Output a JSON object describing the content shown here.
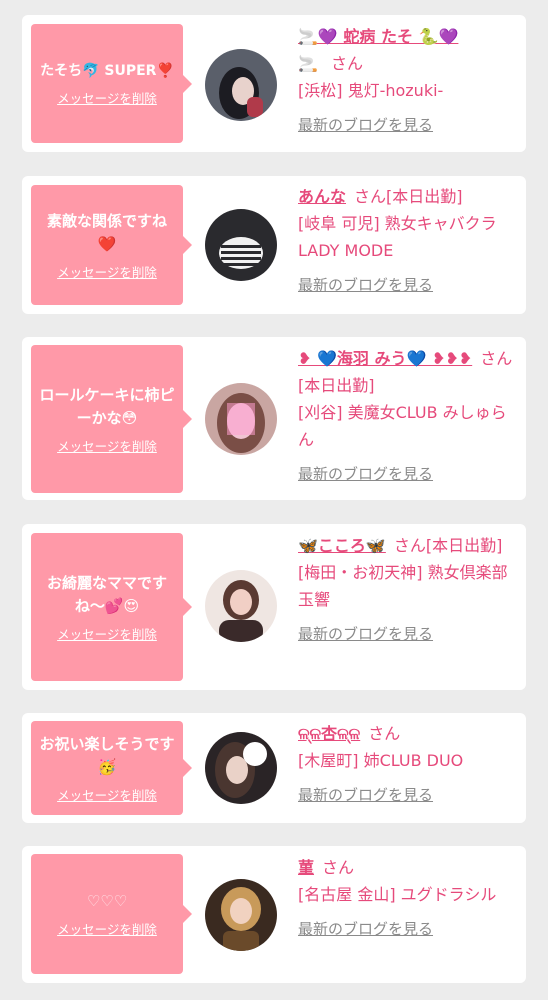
{
  "colors": {
    "page_bg": "#ececec",
    "card_bg": "#ffffff",
    "bubble_bg": "#ff99a8",
    "accent_pink": "#e64a7b",
    "link_gray": "#8a8a8a"
  },
  "common": {
    "delete_label": "メッセージを削除",
    "blog_label": "最新のブログを見る",
    "san_label": "さん"
  },
  "cards": [
    {
      "message": "たそち🐬 SUPER❣️",
      "name": "🚬💜 蛇病 たそ 🐍💜",
      "name_suffix": "🚬",
      "status": "",
      "shop": "[浜松] 鬼灯-hozuki-",
      "avatar_icon": "woman-photo-icon"
    },
    {
      "message": "素敵な関係ですね❤️",
      "name": "あんな",
      "status": "[本日出勤]",
      "shop": "[岐阜 可児] 熟女キャバクラ LADY MODE",
      "avatar_icon": "logo-photo-icon"
    },
    {
      "message": "ロールケーキに柿ピーかな😳",
      "name": "❥ 💙海羽 みう💙 ❥❥❥",
      "status": "[本日出勤]",
      "shop": "[刈谷] 美魔女CLUB みしゅらん",
      "avatar_icon": "blurred-woman-photo-icon"
    },
    {
      "message": "お綺麗なママですね〜💕😍",
      "name": "🦋こころ🦋",
      "status": "[本日出勤]",
      "shop": "[梅田・お初天神] 熟女倶楽部 玉響",
      "avatar_icon": "woman-photo-icon"
    },
    {
      "message": "お祝い楽しそうです🥳",
      "name": "ଳ୍ଳ杏ଳ୍ଳ",
      "status": "",
      "shop": "[木屋町] 姉CLUB DUO",
      "avatar_icon": "woman-photo-icon"
    },
    {
      "message": "♡♡♡",
      "name": "菫",
      "status": "",
      "shop": "[名古屋 金山] ユグドラシル",
      "avatar_icon": "woman-photo-icon"
    }
  ]
}
